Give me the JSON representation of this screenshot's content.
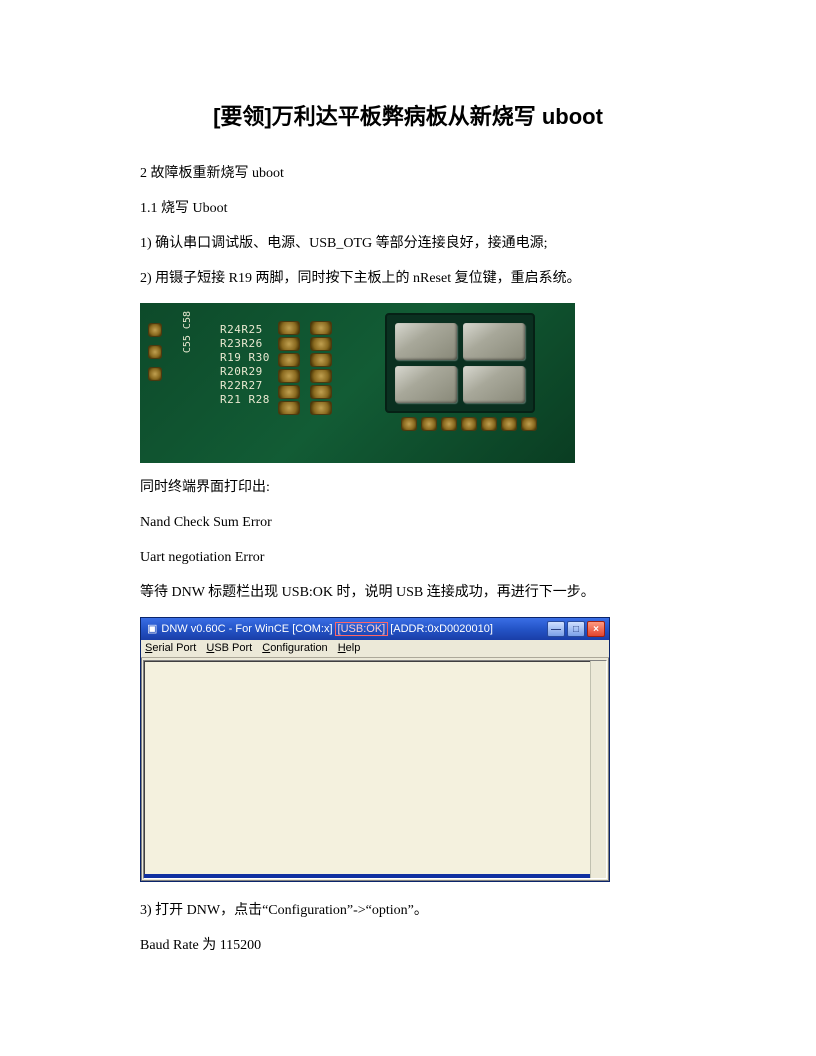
{
  "title": "[要领]万利达平板弊病板从新烧写 uboot",
  "p1": "2 故障板重新烧写 uboot",
  "p2": "1.1 烧写 Uboot",
  "p3": "1) 确认串口调试版、电源、USB_OTG 等部分连接良好，接通电源;",
  "p4": "2) 用镊子短接 R19 两脚，同时按下主板上的 nReset 复位键，重启系统。",
  "pcb": {
    "side": "C55 C58",
    "rows": [
      "R24R25",
      "R23R26",
      "R19 R30",
      "R20R29",
      "R22R27",
      "R21 R28"
    ]
  },
  "p5": "同时终端界面打印出:",
  "p6": "Nand Check Sum Error",
  "p7": "Uart negotiation Error",
  "p8": "等待 DNW 标题栏出现 USB:OK 时，说明 USB 连接成功，再进行下一步。",
  "dnw": {
    "icon": "▣",
    "title_pre": "DNW v0.60C - For WinCE   [COM:x]",
    "title_usb": "[USB:OK]",
    "title_post": "[ADDR:0xD0020010]",
    "min": "—",
    "max": "□",
    "close": "×",
    "menu": {
      "serial": "Serial Port",
      "usb": "USB Port",
      "config": "Configuration",
      "help": "Help"
    }
  },
  "p9": "3) 打开 DNW，点击“Configuration”->“option”。",
  "p10": "Baud Rate 为 115200"
}
